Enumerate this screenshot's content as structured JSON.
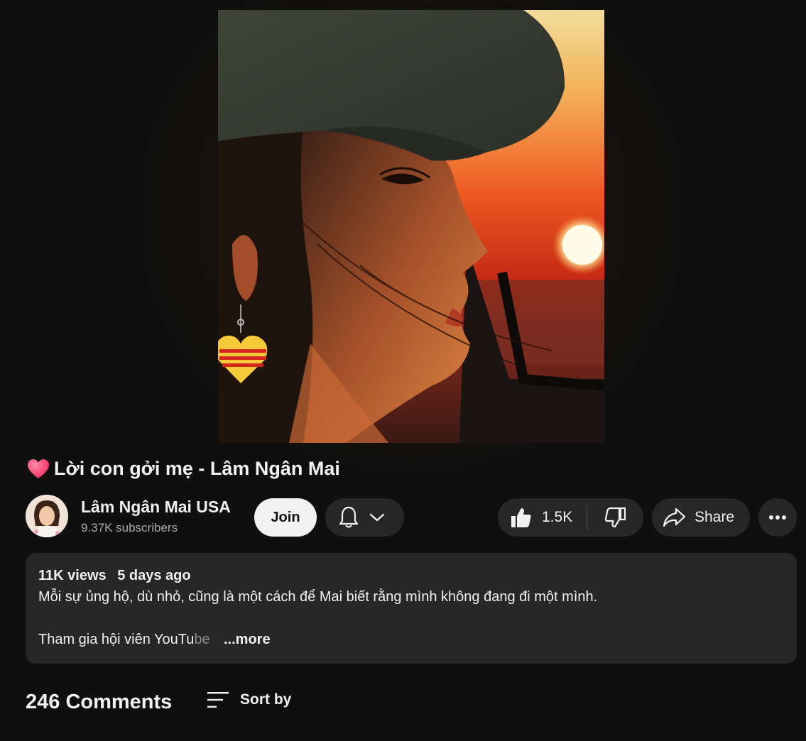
{
  "video": {
    "title": "Lời con gởi mẹ - Lâm Ngân Mai",
    "title_icon": "heart-emoji-icon"
  },
  "channel": {
    "name": "Lâm Ngân Mai USA",
    "subscribers": "9.37K subscribers",
    "join_label": "Join"
  },
  "actions": {
    "like_count": "1.5K",
    "share_label": "Share"
  },
  "description": {
    "views": "11K views",
    "date": "5 days ago",
    "line1": "Mỗi sự ủng hộ, dù nhỏ, cũng là một cách để Mai biết rằng mình không đang đi một mình.",
    "line2_start": "Tham gia hội viên YouTu",
    "line2_fade": "be",
    "more_label": "...more"
  },
  "comments": {
    "count_label": "246 Comments",
    "sort_label": "Sort by"
  },
  "colors": {
    "background": "#0f0f0f",
    "surface": "#272727",
    "text": "#f1f1f1",
    "secondary_text": "#aaaaaa",
    "join_button_bg": "#f1f1f1"
  }
}
